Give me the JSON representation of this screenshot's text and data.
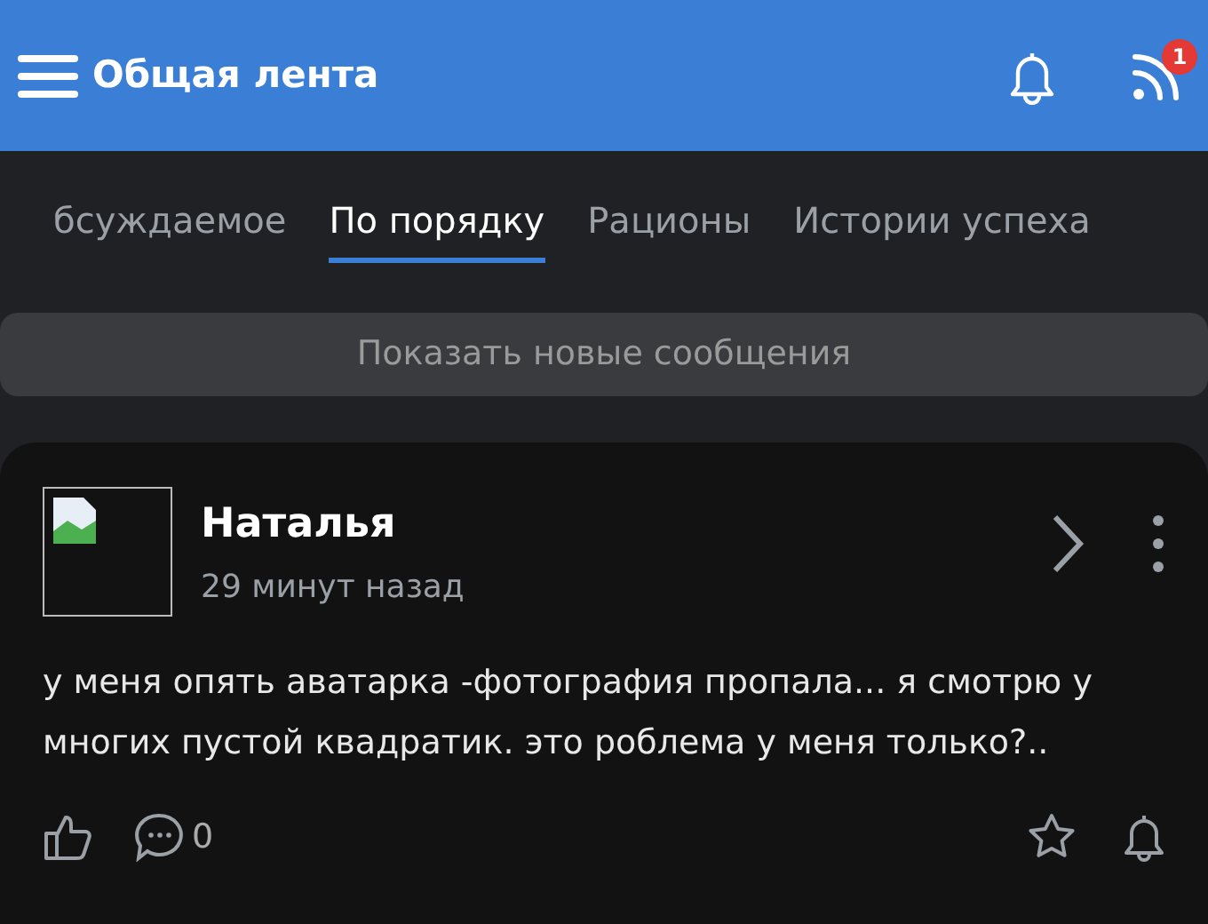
{
  "header": {
    "title": "Общая лента",
    "feed_badge": "1"
  },
  "tabs": [
    {
      "label": "бсуждаемое",
      "selected": false
    },
    {
      "label": "По порядку",
      "selected": true
    },
    {
      "label": "Рационы",
      "selected": false
    },
    {
      "label": "Истории успеха",
      "selected": false
    }
  ],
  "new_messages_button": "Показать новые сообщения",
  "post": {
    "author": "Наталья",
    "time": "29 минут назад",
    "text": "у меня опять аватарка -фотография пропала... я смотрю у многих пустой квадратик. это роблема у меня только?..",
    "comments": "0"
  }
}
